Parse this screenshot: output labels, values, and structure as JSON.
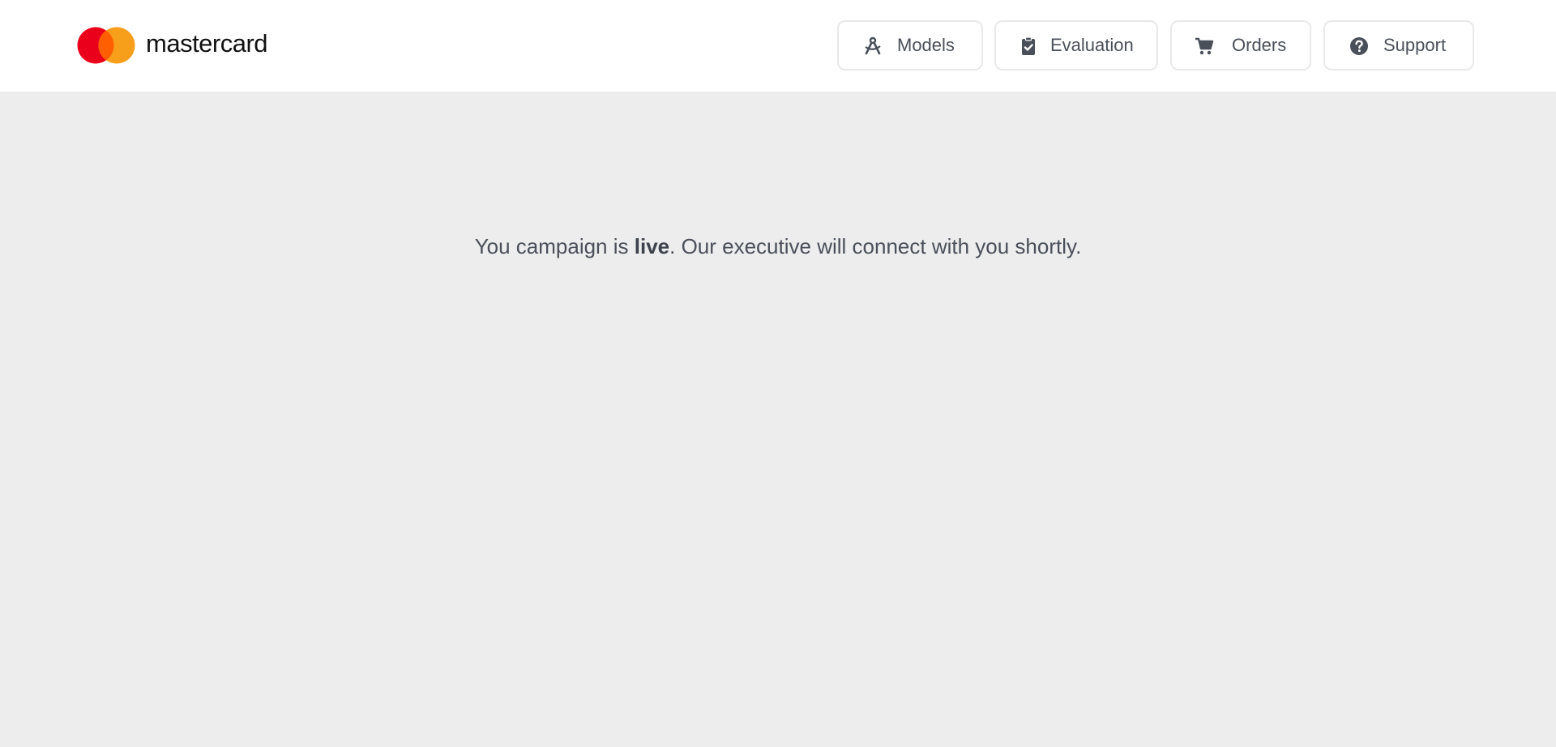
{
  "brand": {
    "name": "mastercard",
    "logo_colors": [
      "#eb001b",
      "#f79e1b",
      "#ff5f00"
    ]
  },
  "nav": {
    "items": [
      {
        "label": "Models",
        "icon": "drafting-compass-icon"
      },
      {
        "label": "Evaluation",
        "icon": "clipboard-check-icon"
      },
      {
        "label": "Orders",
        "icon": "shopping-cart-icon"
      },
      {
        "label": "Support",
        "icon": "question-circle-icon"
      }
    ]
  },
  "main": {
    "message_prefix": "You campaign is ",
    "message_highlight": "live",
    "message_suffix": ". Our executive will connect with you shortly."
  },
  "colors": {
    "header_bg": "#ffffff",
    "page_bg": "#ededed",
    "text": "#4a4f59",
    "button_border": "#e9e9ea"
  }
}
